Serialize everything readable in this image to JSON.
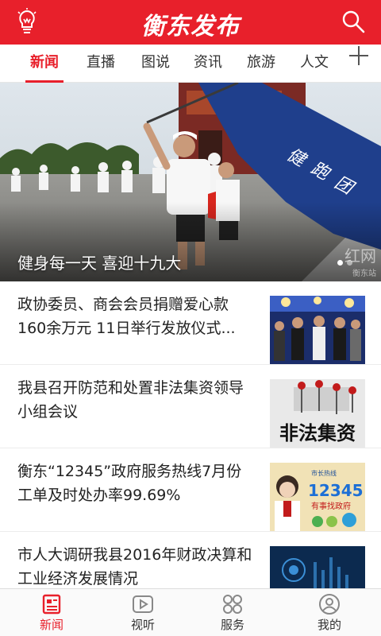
{
  "header": {
    "title": "衡东发布",
    "brand_color": "#e8202b",
    "left_icon": "lightbulb-icon",
    "right_icon": "search-icon"
  },
  "tabs": [
    {
      "label": "新闻",
      "active": true
    },
    {
      "label": "直播",
      "active": false
    },
    {
      "label": "图说",
      "active": false
    },
    {
      "label": "资讯",
      "active": false
    },
    {
      "label": "旅游",
      "active": false
    },
    {
      "label": "人文",
      "active": false
    }
  ],
  "hero": {
    "caption": "健身每一天 喜迎十九大",
    "watermark": "红网",
    "watermark_sub": "衡东站",
    "dots": 2,
    "active_dot": 0
  },
  "news": [
    {
      "title": "政协委员、商会会员捐赠爱心款160余万元 11日举行发放仪式..."
    },
    {
      "title": "我县召开防范和处置非法集资领导小组会议",
      "thumb_text": "非法集资"
    },
    {
      "title": "衡东“12345”政府服务热线7月份工单及时处办率99.69%",
      "thumb_text": "12345",
      "thumb_sub": "有事找政府",
      "thumb_top": "市长热线"
    },
    {
      "title": "市人大调研我县2016年财政决算和工业经济发展情况"
    }
  ],
  "bottom_nav": [
    {
      "label": "新闻",
      "icon": "news-icon",
      "active": true
    },
    {
      "label": "视听",
      "icon": "play-icon",
      "active": false
    },
    {
      "label": "服务",
      "icon": "grid-icon",
      "active": false
    },
    {
      "label": "我的",
      "icon": "user-icon",
      "active": false
    }
  ]
}
